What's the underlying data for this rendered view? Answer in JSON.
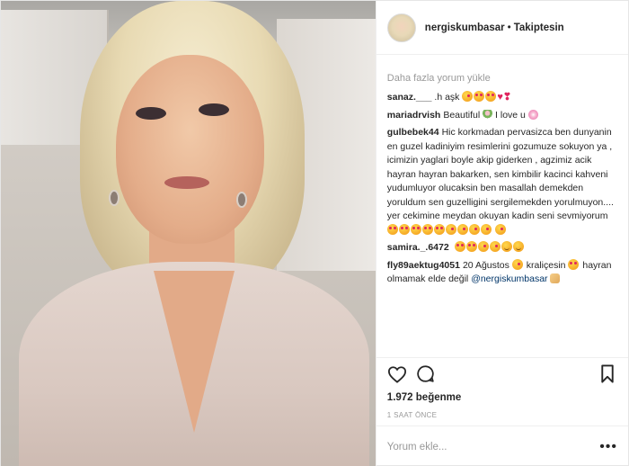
{
  "header": {
    "username": "nergiskumbasar",
    "separator": "•",
    "follow_status": "Takiptesin"
  },
  "load_more": "Daha fazla yorum yükle",
  "comments": [
    {
      "user": "sanaz.___",
      "text": ".h aşk"
    },
    {
      "user": "mariadrvish",
      "text": "Beautiful",
      "text2": "I love u"
    },
    {
      "user": "gulbebek44",
      "text": "Hic korkmadan pervasizca ben dunyanin en guzel kadiniyim resimlerini gozumuze sokuyon ya , icimizin yaglari boyle akip giderken , agzimiz acik hayran hayran bakarken, sen kimbilir kacinci kahveni yudumluyor olucaksin ben masallah demekden yoruldum sen guzelligini sergilemekden yorulmuyon.... yer cekimine meydan okuyan kadin seni sevmiyorum"
    },
    {
      "user": "samira._.6472",
      "text": ""
    },
    {
      "user": "fly89aektug4051",
      "text": "20 Ağustos",
      "text2": "kraliçesin",
      "text3": "hayran olmamak elde değil",
      "mention": "@nergiskumbasar"
    }
  ],
  "likes": "1.972 beğenme",
  "timestamp": "1 SAAT ÖNCE",
  "add_comment": {
    "placeholder": "Yorum ekle...",
    "value": ""
  },
  "icons": {
    "like": "heart-outline-icon",
    "comment": "speech-bubble-icon",
    "save": "bookmark-icon",
    "more": "more-dots-icon"
  },
  "colors": {
    "text": "#262626",
    "muted": "#999999",
    "mention": "#003569",
    "border": "#efefef"
  }
}
